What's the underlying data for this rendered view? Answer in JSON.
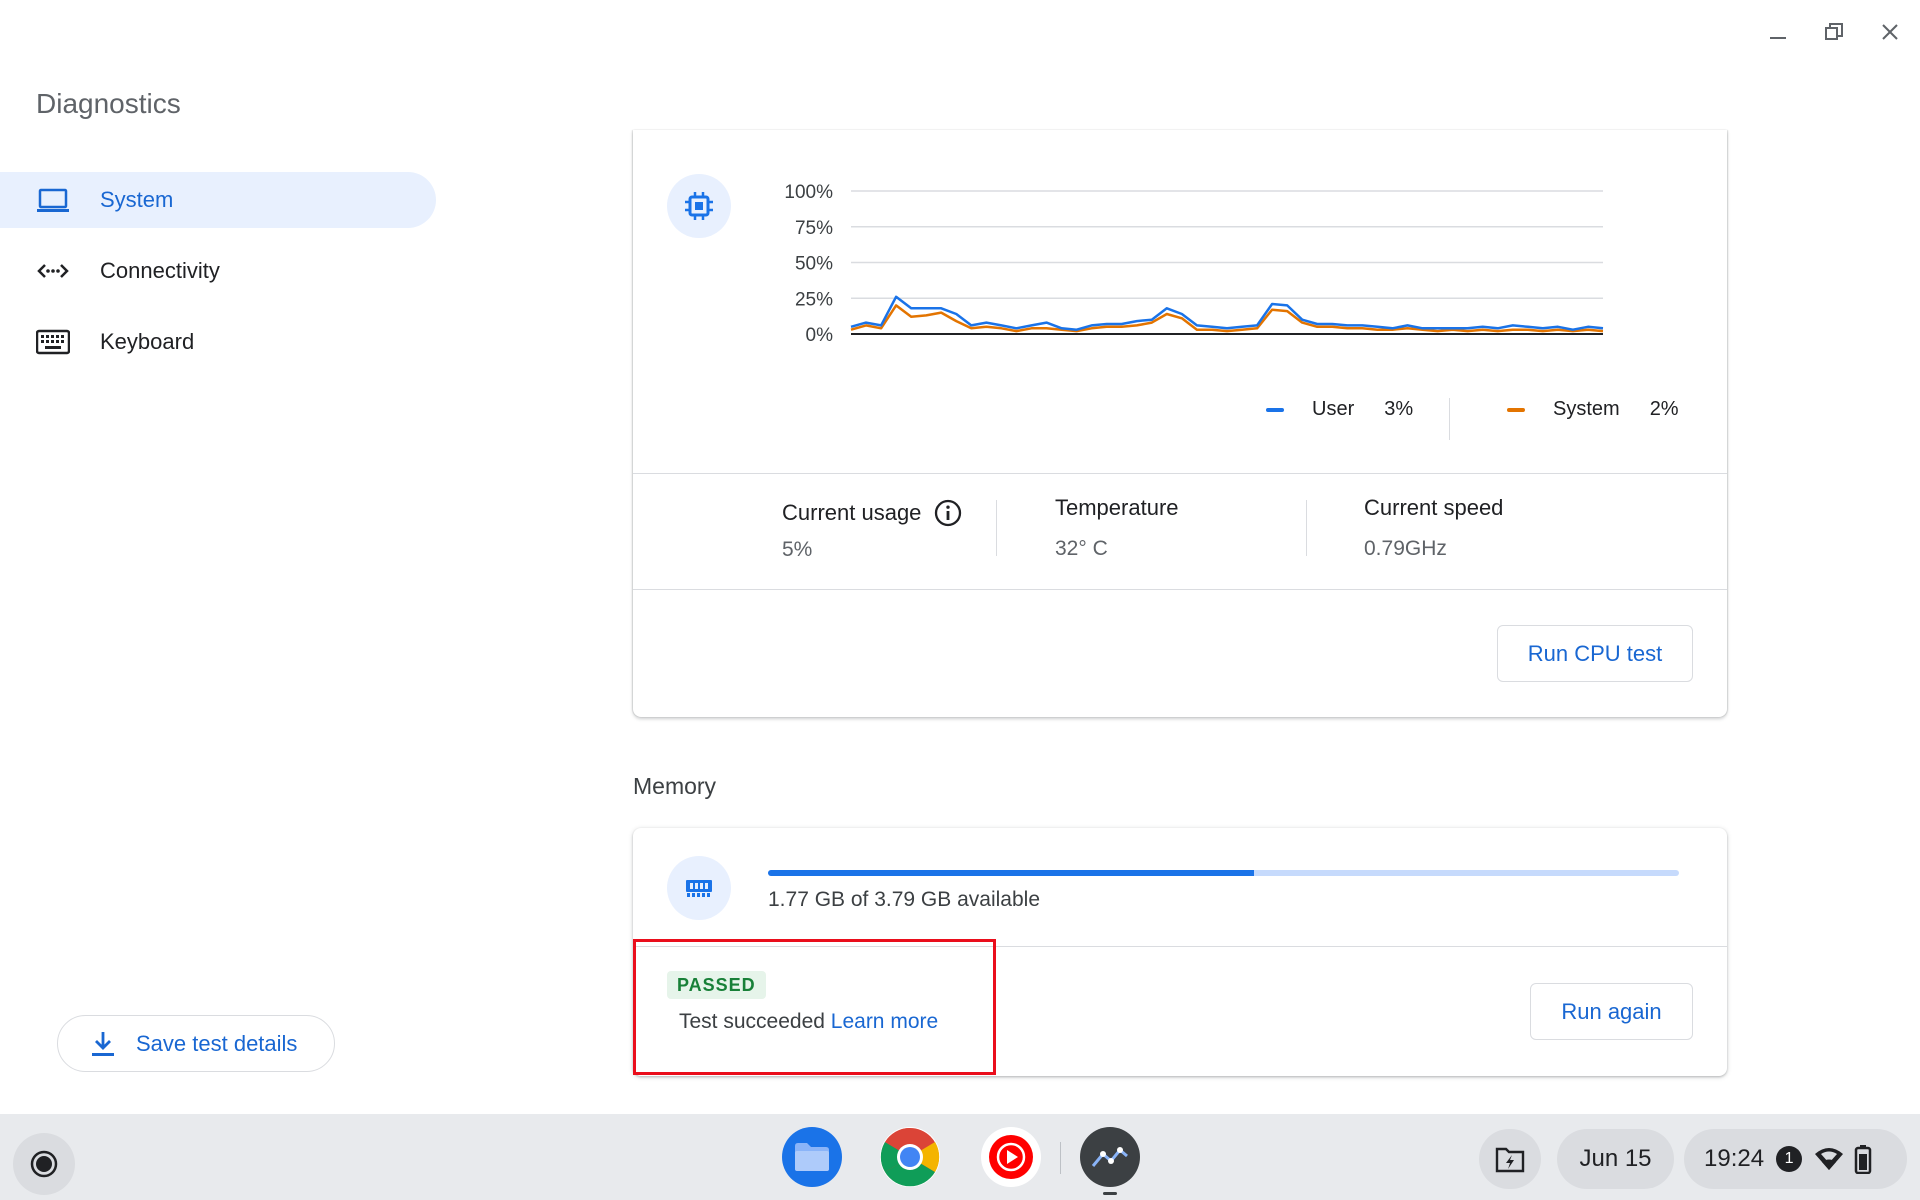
{
  "window": {
    "title": "Diagnostics",
    "minimize_icon": "minimize-icon",
    "maximize_icon": "restore-icon",
    "close_icon": "close-icon"
  },
  "sidebar": {
    "items": [
      {
        "label": "System",
        "icon": "laptop-icon",
        "active": true
      },
      {
        "label": "Connectivity",
        "icon": "connectivity-icon",
        "active": false
      },
      {
        "label": "Keyboard",
        "icon": "keyboard-icon",
        "active": false
      }
    ],
    "save_label": "Save test details"
  },
  "cpu": {
    "stats": {
      "usage_label": "Current usage",
      "usage_value": "5%",
      "temp_label": "Temperature",
      "temp_value": "32° C",
      "speed_label": "Current speed",
      "speed_value": "0.79GHz"
    },
    "button_label": "Run CPU test"
  },
  "chart_data": {
    "type": "line",
    "y_tick_labels": [
      "100%",
      "75%",
      "50%",
      "25%",
      "0%"
    ],
    "ylim": [
      0,
      100
    ],
    "grid": true,
    "legend_placement": "bottom-right",
    "series": [
      {
        "name": "User",
        "current_label": "3%",
        "color": "#1a73e8",
        "values": [
          5,
          8,
          6,
          26,
          18,
          18,
          18,
          14,
          6,
          8,
          6,
          4,
          6,
          8,
          4,
          3,
          6,
          7,
          7,
          9,
          10,
          18,
          14,
          6,
          5,
          4,
          5,
          6,
          21,
          20,
          10,
          7,
          7,
          6,
          6,
          5,
          4,
          6,
          4,
          4,
          4,
          4,
          5,
          4,
          6,
          5,
          4,
          5,
          3,
          5,
          4
        ]
      },
      {
        "name": "System",
        "current_label": "2%",
        "color": "#e37400",
        "values": [
          3,
          6,
          4,
          20,
          12,
          13,
          15,
          9,
          4,
          5,
          4,
          2,
          4,
          4,
          3,
          2,
          4,
          5,
          5,
          6,
          8,
          14,
          11,
          3,
          3,
          2,
          3,
          4,
          17,
          16,
          8,
          5,
          5,
          4,
          4,
          3,
          3,
          4,
          3,
          2,
          3,
          2,
          3,
          2,
          3,
          3,
          2,
          3,
          2,
          3,
          2
        ]
      }
    ]
  },
  "memory": {
    "title": "Memory",
    "available_text": "1.77 GB of 3.79 GB available",
    "used_fraction": 0.533,
    "status_badge": "PASSED",
    "result_text": "Test succeeded",
    "learn_more": "Learn more",
    "button_label": "Run again"
  },
  "colors": {
    "accent": "#1a73e8",
    "link": "#1967d2",
    "passed_bg": "#e6f4ea",
    "passed_text": "#188038",
    "highlight": "#ea0e1c"
  },
  "shelf": {
    "launcher_icon": "launcher-icon",
    "apps": [
      {
        "name": "files-app-icon"
      },
      {
        "name": "chrome-app-icon"
      },
      {
        "name": "youtube-music-app-icon"
      },
      {
        "name": "diagnostics-app-icon"
      }
    ],
    "holding_space_icon": "holding-space-icon",
    "date": "Jun 15",
    "time": "19:24",
    "notification_count": "1",
    "wifi_icon": "wifi-icon",
    "battery_icon": "battery-icon"
  }
}
